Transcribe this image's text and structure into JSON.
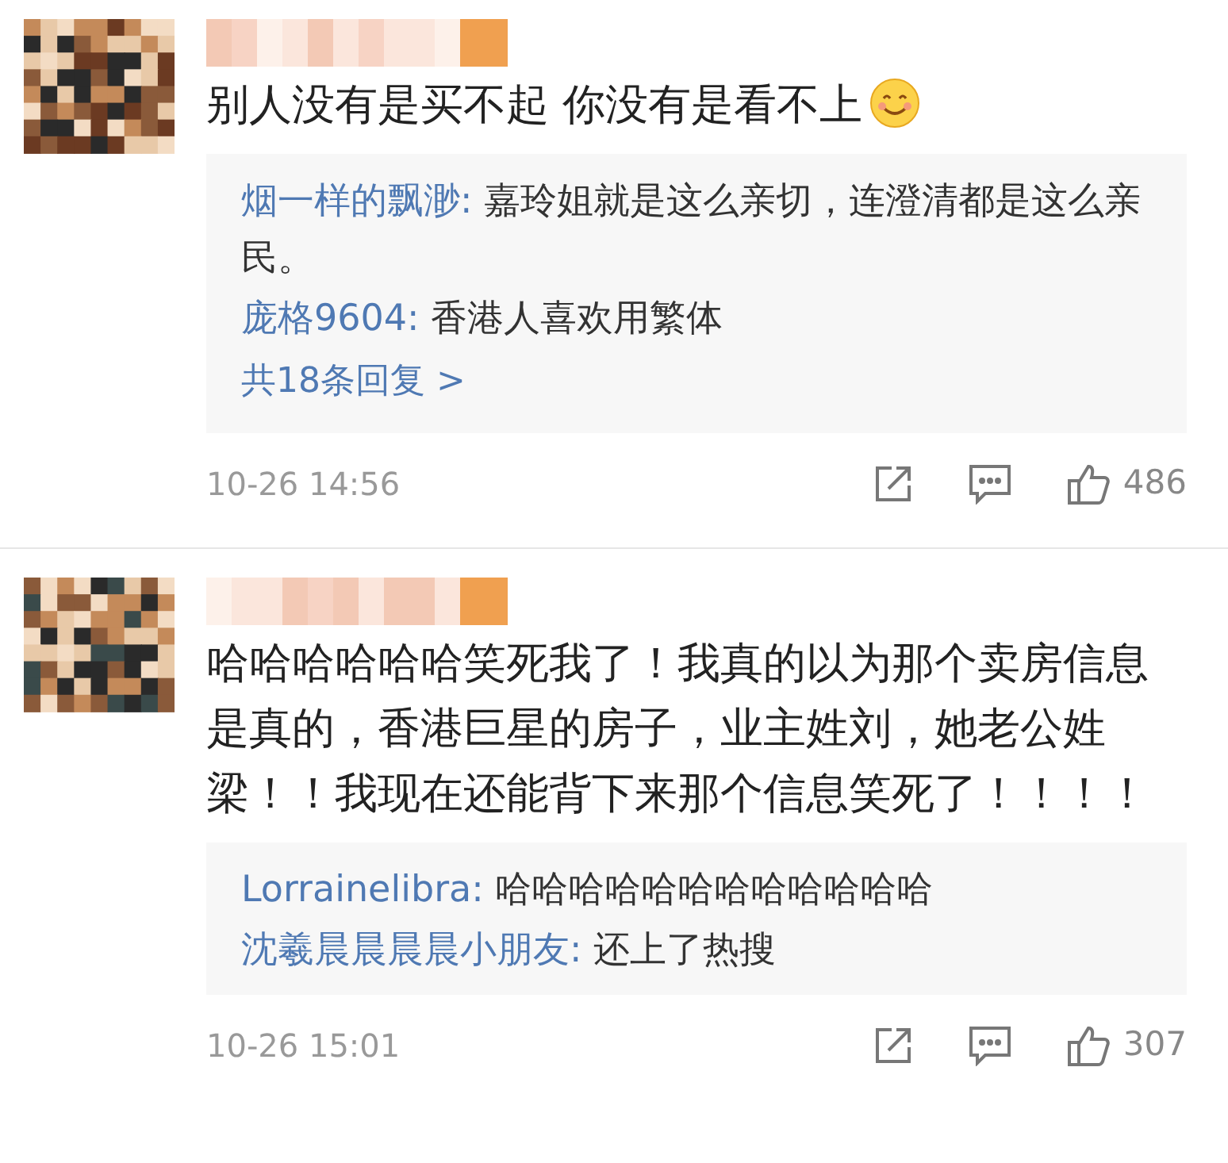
{
  "comments": [
    {
      "text": "别人没有是买不起 你没有是看不上",
      "emoji": true,
      "replies": [
        {
          "author": "烟一样的飘渺:",
          "text": "嘉玲姐就是这么亲切，连澄清都是这么亲民。"
        },
        {
          "author": "庞格9604:",
          "text": "香港人喜欢用繁体"
        }
      ],
      "more": "共18条回复 >",
      "time": "10-26 14:56",
      "likes": "486"
    },
    {
      "text": "哈哈哈哈哈哈笑死我了！我真的以为那个卖房信息是真的，香港巨星的房子，业主姓刘，她老公姓梁！！我现在还能背下来那个信息笑死了！！！！",
      "emoji": false,
      "replies": [
        {
          "author": "Lorrainelibra:",
          "text": "哈哈哈哈哈哈哈哈哈哈哈哈"
        },
        {
          "author": "沈羲晨晨晨晨小朋友:",
          "text": "还上了热搜"
        }
      ],
      "time": "10-26 15:01",
      "likes": "307"
    }
  ]
}
